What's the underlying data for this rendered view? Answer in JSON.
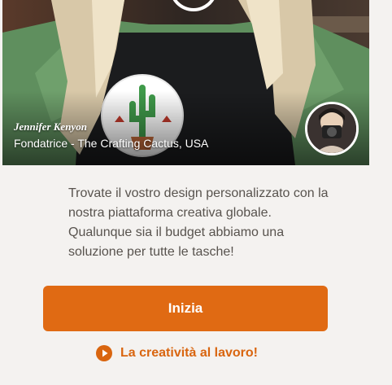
{
  "hero": {
    "person_name": "Jennifer Kenyon",
    "caption": "Fondatrice - The Crafting Cactus, USA",
    "apron_logo_text": "the crafting cactus"
  },
  "description": "Trovate il vostro design personalizzato con la nostra piattaforma creativa globale. Qualunque sia il budget abbiamo una soluzione per tutte le tasche!",
  "cta": {
    "label": "Inizia"
  },
  "video_link": {
    "label": "La creatività al lavoro!",
    "icon": "play-circle-icon"
  },
  "colors": {
    "accent": "#e06a13",
    "link": "#d9650f",
    "text": "#58534e",
    "background": "#f4f2f0"
  }
}
